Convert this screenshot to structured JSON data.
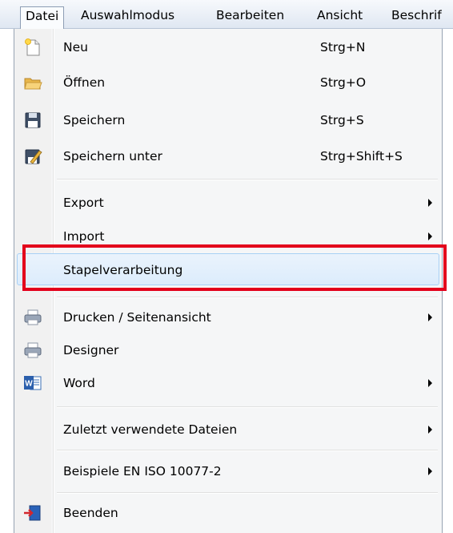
{
  "menubar": {
    "items": [
      "Datei",
      "Auswahlmodus",
      "Bearbeiten",
      "Ansicht",
      "Beschrif"
    ]
  },
  "menu": {
    "items": [
      {
        "label": "Neu",
        "shortcut": "Strg+N",
        "icon": "new-document-icon"
      },
      {
        "label": "Öffnen",
        "shortcut": "Strg+O",
        "icon": "open-folder-icon"
      },
      {
        "label": "Speichern",
        "shortcut": "Strg+S",
        "icon": "save-disk-icon"
      },
      {
        "label": "Speichern unter",
        "shortcut": "Strg+Shift+S",
        "icon": "save-as-icon"
      },
      {
        "label": "Export",
        "submenu": true
      },
      {
        "label": "Import",
        "submenu": true
      },
      {
        "label": "Stapelverarbeitung",
        "selected": true
      },
      {
        "label": "Drucken / Seitenansicht",
        "submenu": true,
        "icon": "printer-icon"
      },
      {
        "label": "Designer",
        "icon": "designer-printer-icon"
      },
      {
        "label": "Word",
        "submenu": true,
        "icon": "word-icon"
      },
      {
        "label": "Zuletzt verwendete Dateien",
        "submenu": true
      },
      {
        "label": "Beispiele EN ISO 10077-2",
        "submenu": true
      },
      {
        "label": "Beenden",
        "icon": "exit-door-icon"
      }
    ]
  },
  "colors": {
    "highlight_border": "#e3001b",
    "selected_fill": "#dcecfc",
    "menu_background": "#f5f6f7"
  }
}
